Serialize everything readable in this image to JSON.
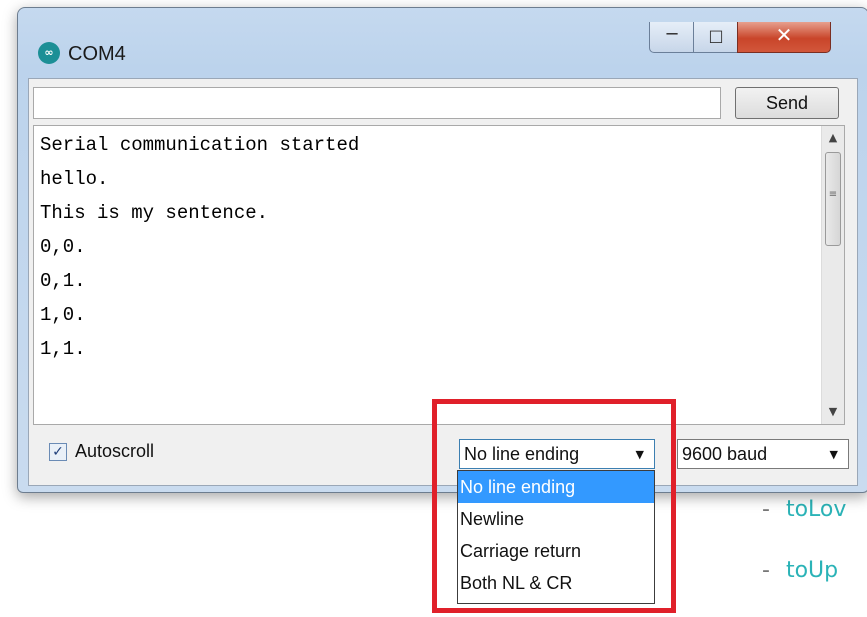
{
  "window": {
    "title": "COM4",
    "icon": "arduino-icon",
    "icon_glyph": "∞",
    "controls": {
      "minimize": "─",
      "maximize": "□",
      "close": "✕"
    }
  },
  "send_bar": {
    "input_value": "",
    "send_label": "Send"
  },
  "output": {
    "lines": [
      "Serial communication started",
      "hello.",
      "This is my sentence.",
      "0,0.",
      "0,1.",
      "1,0.",
      "1,1."
    ]
  },
  "footer": {
    "autoscroll_label": "Autoscroll",
    "autoscroll_checked": true,
    "check_glyph": "✓",
    "line_ending_selected": "No line ending",
    "baud_selected": "9600 baud",
    "caret": "▼"
  },
  "dropdown_options": [
    "No line ending",
    "Newline",
    "Carriage return",
    "Both NL & CR"
  ],
  "background_items": [
    {
      "dash": "-",
      "text": "toLov"
    },
    {
      "dash": "-",
      "text": "toUp"
    }
  ],
  "colors": {
    "highlight": "#e0202a",
    "selection": "#3399ff",
    "link": "#2bb3b7"
  }
}
